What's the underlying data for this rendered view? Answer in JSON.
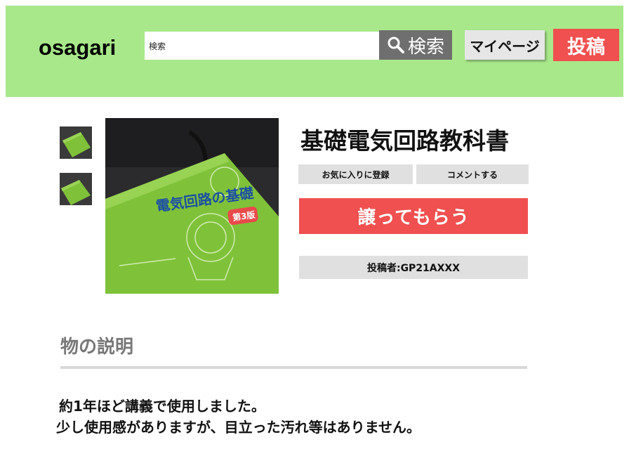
{
  "header": {
    "logo": "osagari",
    "search": {
      "value": "検索",
      "button_label": "検索"
    },
    "mypage_label": "マイページ",
    "post_label": "投稿"
  },
  "product": {
    "title": "基礎電気回路教科書",
    "book_cover_title": "電気回路の基礎",
    "book_edition": "第3版",
    "favorite_label": "お気に入りに登録",
    "comment_label": "コメントする",
    "receive_label": "譲ってもらう",
    "poster_label": "投稿者:GP21AXXX"
  },
  "description": {
    "heading": "物の説明",
    "lines": [
      "約1年ほど講義で使用しました。",
      "少し使用感がありますが、目立った汚れ等はありません。"
    ]
  },
  "colors": {
    "header_bg": "#a8e88a",
    "accent_red": "#f05050",
    "search_button": "#6f6f6f",
    "book_green": "#7fc23a"
  }
}
